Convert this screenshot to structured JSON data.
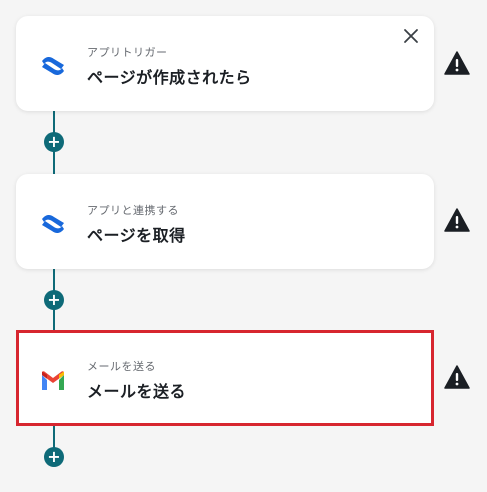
{
  "steps": [
    {
      "subtitle": "アプリトリガー",
      "title": "ページが作成されたら",
      "icon": "confluence-icon",
      "has_close": true,
      "warning": true
    },
    {
      "subtitle": "アプリと連携する",
      "title": "ページを取得",
      "icon": "confluence-icon",
      "has_close": false,
      "warning": true
    },
    {
      "subtitle": "メールを送る",
      "title": "メールを送る",
      "icon": "gmail-icon",
      "has_close": false,
      "warning": true,
      "highlighted": true
    }
  ],
  "add_step_label": "+",
  "colors": {
    "connector": "#0e6a78",
    "highlight_border": "#d7262f",
    "confluence_blue": "#1868db",
    "warning": "#1b1f24"
  }
}
